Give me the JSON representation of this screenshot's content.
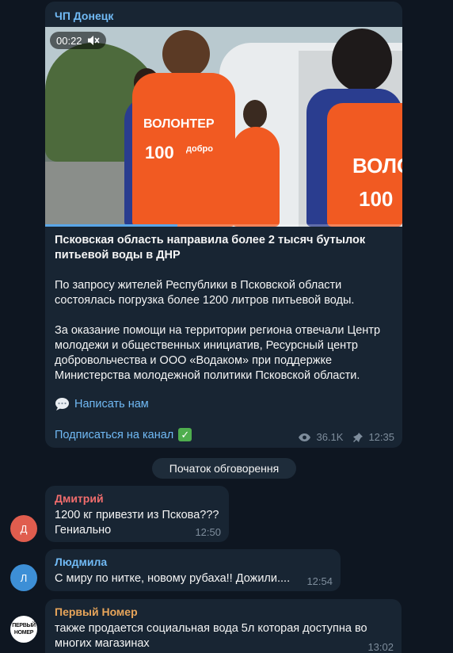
{
  "post": {
    "channel_name": "ЧП Донецк",
    "video_time": "00:22",
    "video_progress": 0.37,
    "vest_text_1": "ВОЛОНТЕР",
    "vest_text_2": "100",
    "vest_text_3": "добро",
    "vest_text_4": "ВОЛО",
    "vest_text_5": "100",
    "title": "Псковская область направила более 2 тысяч бутылок питьевой воды в ДНР",
    "paragraph_1": "По запросу жителей Республики в Псковской области состоялась погрузка более 1200 литров питьевой воды.",
    "paragraph_2": "За оказание помощи на территории региона отвечали Центр молодежи и общественных инициатив, Ресурсный центр добровольчества и ООО «Водаком» при поддержке Министерства молодежной политики Псковской области.",
    "write_us": "Написать нам",
    "subscribe": "Подписаться на канал",
    "views": "36.1K",
    "time": "12:35"
  },
  "discussion_label": "Початок обговорення",
  "comments": [
    {
      "avatar_letter": "Д",
      "author": "Дмитрий",
      "line1": "1200 кг привезти из Пскова???",
      "line2": "Гениально",
      "time": "12:50",
      "author_color": "#f26d6d",
      "avatar_color": "#e05d4e"
    },
    {
      "avatar_letter": "Л",
      "author": "Людмила",
      "line1": "С миру по нитке, новому рубаха!! Дожили....",
      "time": "12:54",
      "author_color": "#71baf5",
      "avatar_color": "#3d8fd6"
    },
    {
      "avatar_letter": "ПЕРВЫЙ НОМЕР",
      "author": "Первый Номер",
      "line1": "также продается социальная вода 5л которая доступна во",
      "line2": "многих магазинах",
      "time": "13:02",
      "author_color": "#e8a55a"
    }
  ],
  "colors": {
    "accent": "#71baf5",
    "background": "#0e1621",
    "bubble": "#182533"
  }
}
